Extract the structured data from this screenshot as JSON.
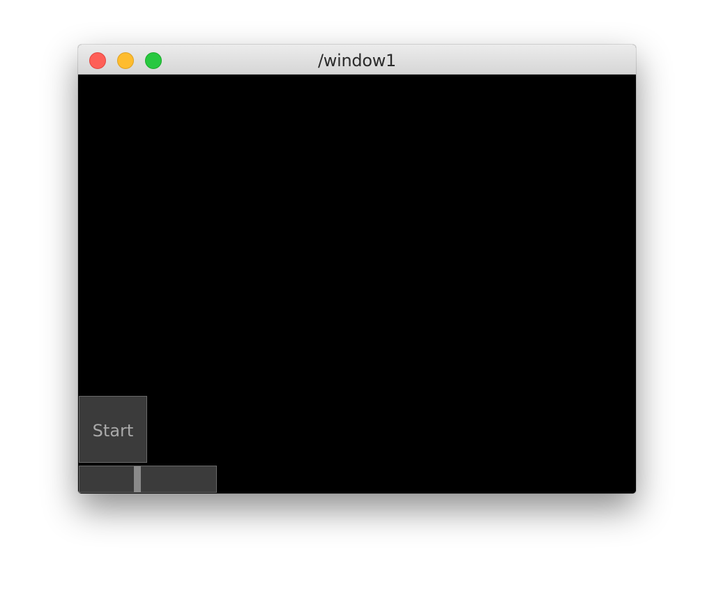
{
  "window": {
    "title": "/window1"
  },
  "controls": {
    "start_button_label": "Start",
    "slider_value_fraction": 0.42
  },
  "icons": {
    "close": "close-circle-icon",
    "minimize": "minimize-circle-icon",
    "zoom": "zoom-circle-icon"
  },
  "colors": {
    "canvas_background": "#000000",
    "control_fill": "#3b3b3b",
    "control_border": "#6a6a6a",
    "control_text": "#a9a9a9",
    "close": "#fe5f57",
    "minimize": "#febc2e",
    "zoom": "#28c840"
  }
}
